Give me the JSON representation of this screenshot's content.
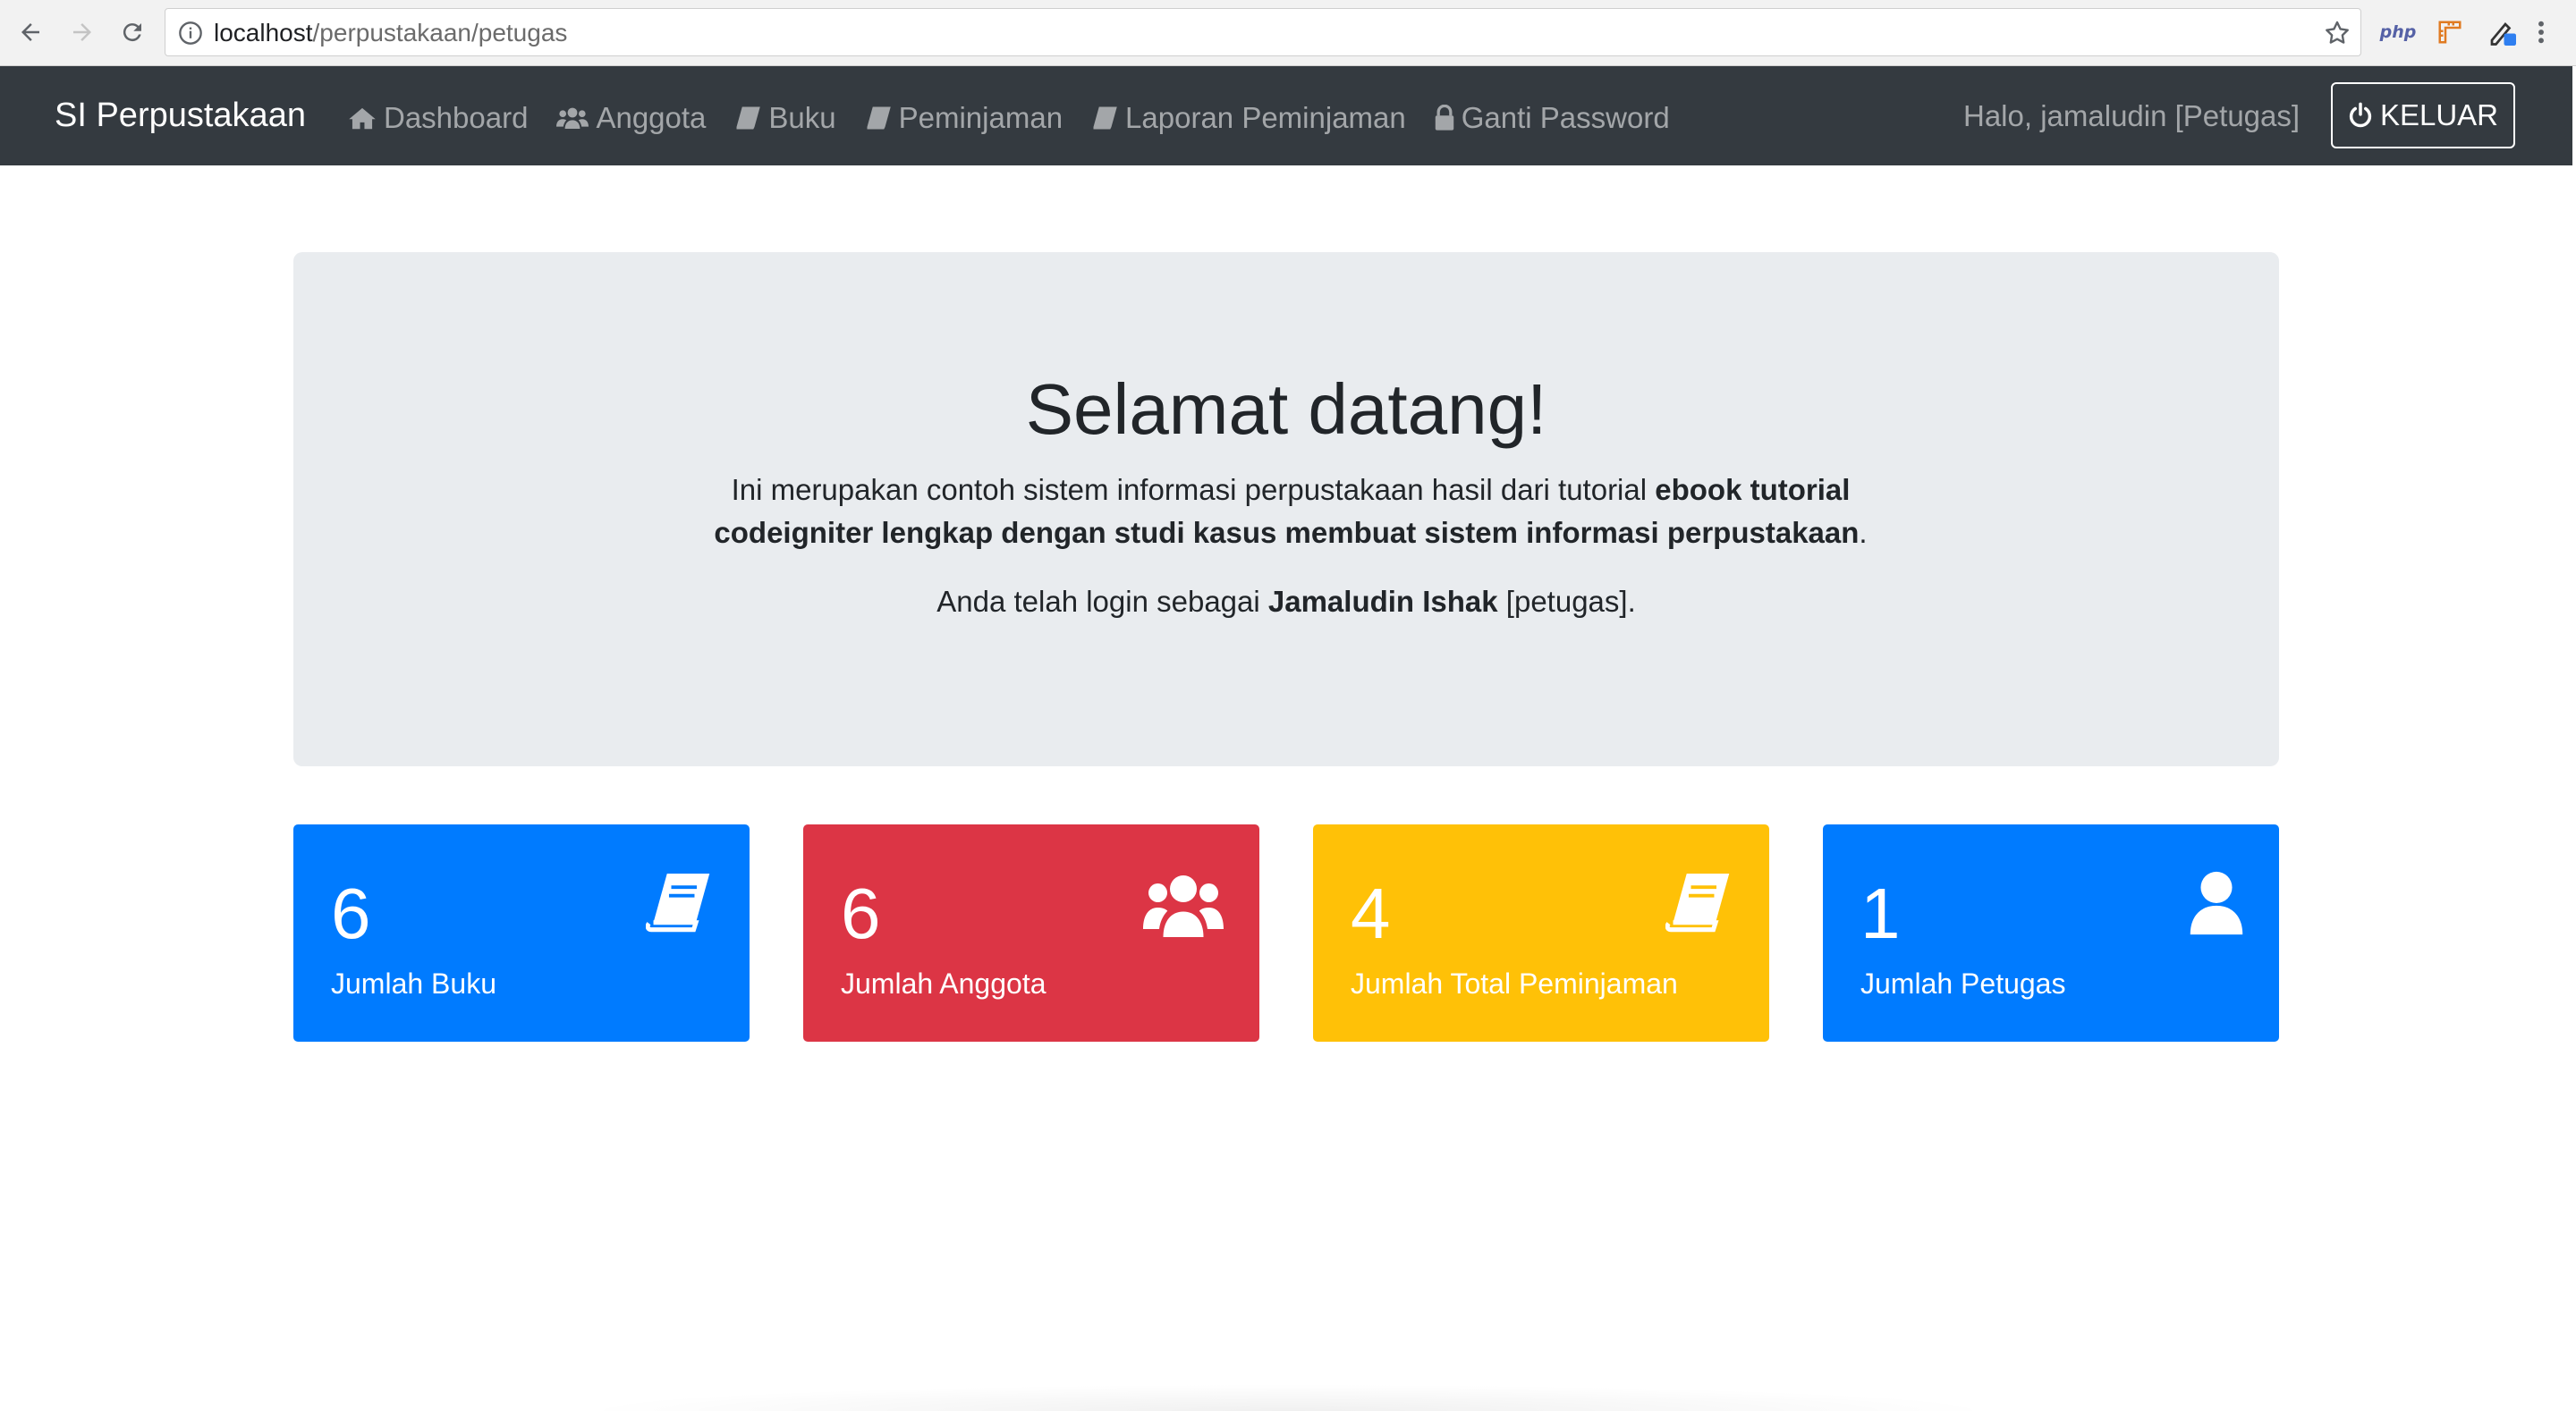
{
  "browser": {
    "url_host": "localhost",
    "url_path": "/perpustakaan/petugas",
    "extension_php_label": "php"
  },
  "navbar": {
    "brand": "SI Perpustakaan",
    "items": [
      {
        "label": "Dashboard",
        "icon": "home-icon"
      },
      {
        "label": "Anggota",
        "icon": "users-icon"
      },
      {
        "label": "Buku",
        "icon": "book-icon"
      },
      {
        "label": "Peminjaman",
        "icon": "book-icon"
      },
      {
        "label": "Laporan Peminjaman",
        "icon": "book-icon"
      },
      {
        "label": "Ganti Password",
        "icon": "lock-icon"
      }
    ],
    "greeting": "Halo, jamaludin [Petugas]",
    "logout_label": "KELUAR",
    "logout_icon": "power-icon"
  },
  "jumbotron": {
    "title": "Selamat datang!",
    "lead_text": "Ini merupakan contoh sistem informasi perpustakaan hasil dari tutorial ",
    "lead_bold": "ebook tutorial codeigniter lengkap dengan studi kasus membuat sistem informasi perpustakaan",
    "lead_end": ".",
    "login_prefix": "Anda telah login sebagai ",
    "login_name": "Jamaludin Ishak",
    "login_suffix": " [petugas]."
  },
  "stats": [
    {
      "value": "6",
      "label": "Jumlah Buku",
      "icon": "book-icon",
      "color": "#007bff"
    },
    {
      "value": "6",
      "label": "Jumlah Anggota",
      "icon": "users-icon",
      "color": "#dc3545"
    },
    {
      "value": "4",
      "label": "Jumlah Total Peminjaman",
      "icon": "book-icon",
      "color": "#ffc107"
    },
    {
      "value": "1",
      "label": "Jumlah Petugas",
      "icon": "user-icon",
      "color": "#007bff"
    }
  ]
}
